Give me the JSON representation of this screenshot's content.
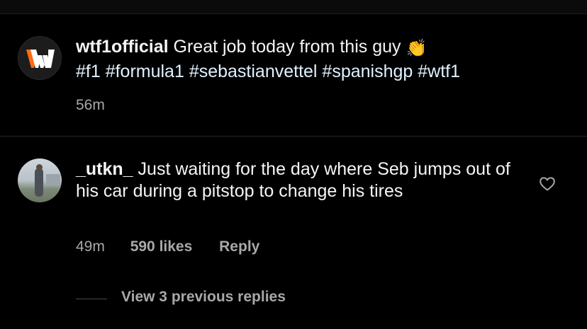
{
  "caption": {
    "username": "wtf1official",
    "text": "Great job today from this guy",
    "emoji": "👏",
    "hashtags": "#f1 #formula1 #sebastianvettel #spanishgp #wtf1",
    "time": "56m"
  },
  "comment": {
    "username": "_utkn_",
    "text": "Just waiting for the day where Seb jumps out of his car during a pitstop to change his tires",
    "time": "49m",
    "likes": "590 likes",
    "reply_label": "Reply",
    "view_replies": "View 3 previous replies"
  },
  "icons": {
    "like": "heart-icon",
    "brand": "wtf1-logo-icon"
  },
  "colors": {
    "background": "#000000",
    "text": "#f5f5f5",
    "secondary": "#a8a8a8",
    "hashtag": "#e0f1ff",
    "brand_orange": "#ff6a13"
  }
}
